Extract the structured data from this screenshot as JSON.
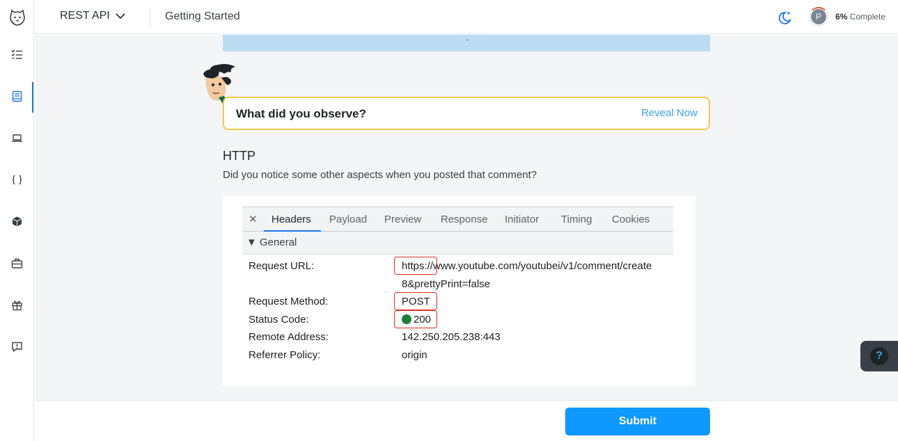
{
  "topbar": {
    "course": "REST API",
    "lesson": "Getting Started",
    "progress_letter": "P",
    "progress_pct": "6%",
    "progress_label": "Complete"
  },
  "sidebar": {
    "items": [
      {
        "icon": "checklist-icon",
        "active": false
      },
      {
        "icon": "book-icon",
        "active": true
      },
      {
        "icon": "laptop-icon",
        "active": false
      },
      {
        "icon": "braces-icon",
        "active": false
      },
      {
        "icon": "cube-icon",
        "active": false
      },
      {
        "icon": "briefcase-icon",
        "active": false
      },
      {
        "icon": "gift-icon",
        "active": false
      },
      {
        "icon": "feedback-icon",
        "active": false
      }
    ]
  },
  "main": {
    "observe_question": "What did you observe?",
    "reveal_label": "Reveal Now",
    "heading": "HTTP",
    "paragraph": "Did you notice some other aspects when you posted that comment?"
  },
  "devtools": {
    "close": "✕",
    "tabs": [
      "Headers",
      "Payload",
      "Preview",
      "Response",
      "Initiator",
      "Timing",
      "Cookies"
    ],
    "active_tab": "Headers",
    "section": "▼ General",
    "rows": [
      {
        "label": "Request URL:",
        "value": "https://www.youtube.com/youtubei/v1/comment/create",
        "value2": "8&prettyPrint=false"
      },
      {
        "label": "Request Method:",
        "value": "POST"
      },
      {
        "label": "Status Code:",
        "value": "200"
      },
      {
        "label": "Remote Address:",
        "value": "142.250.205.238:443"
      },
      {
        "label": "Referrer Policy:",
        "value": "origin"
      }
    ]
  },
  "footer": {
    "submit_label": "Submit"
  },
  "help": {
    "label": "?"
  },
  "colors": {
    "accent": "#0d99ff",
    "observe_border": "#f2c94c",
    "highlight": "#d93025",
    "status_ok": "#188038"
  }
}
